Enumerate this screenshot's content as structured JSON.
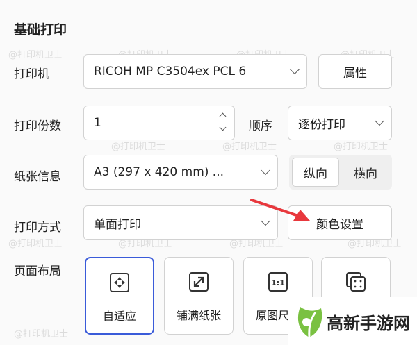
{
  "section_title": "基础打印",
  "printer": {
    "label": "打印机",
    "value": "RICOH MP C3504ex PCL 6",
    "properties_button": "属性"
  },
  "copies": {
    "label": "打印份数",
    "value": "1",
    "order_label": "顺序",
    "order_value": "逐份打印"
  },
  "paper": {
    "label": "纸张信息",
    "value": "A3 (297 x 420 mm) ...",
    "orientation": {
      "portrait": "纵向",
      "landscape": "横向",
      "selected": "纵向"
    }
  },
  "print_mode": {
    "label": "打印方式",
    "value": "单面打印",
    "color_button": "颜色设置"
  },
  "page_layout": {
    "label": "页面布局",
    "options": [
      {
        "label": "自适应",
        "icon": "fit-icon",
        "selected": true
      },
      {
        "label": "铺满纸张",
        "icon": "expand-icon",
        "selected": false
      },
      {
        "label": "原图尺寸",
        "icon": "actual-size-icon",
        "selected": false
      },
      {
        "label": "",
        "icon": "multi-page-icon",
        "selected": false
      }
    ]
  },
  "watermark": "@打印机卫士",
  "logo": {
    "text": "高新手游网",
    "accent": "#7ac142"
  },
  "colors": {
    "accent": "#3a5bd9",
    "arrow": "#e8383d"
  }
}
